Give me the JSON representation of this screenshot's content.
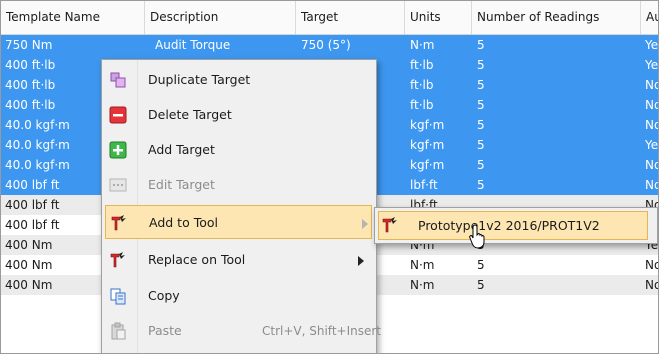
{
  "table": {
    "columns": [
      "Template Name",
      "Description",
      "Target",
      "Units",
      "Number of Readings",
      "Au"
    ],
    "rows": [
      {
        "name": "750 Nm",
        "desc": "Audit Torque",
        "target": "750 (5°)",
        "units": "N·m",
        "readings": "5",
        "au": "Ye",
        "state": "sel"
      },
      {
        "name": "400 ft·lb",
        "desc": "",
        "target": "",
        "units": "ft·lb",
        "readings": "5",
        "au": "Ye",
        "state": "sel"
      },
      {
        "name": "400 ft·lb",
        "desc": "",
        "target": "",
        "units": "ft·lb",
        "readings": "5",
        "au": "No",
        "state": "sel"
      },
      {
        "name": "400 ft·lb",
        "desc": "",
        "target": "",
        "units": "ft·lb",
        "readings": "5",
        "au": "No",
        "state": "sel"
      },
      {
        "name": "40.0 kgf·m",
        "desc": "",
        "target": "",
        "units": "kgf·m",
        "readings": "5",
        "au": "No",
        "state": "sel"
      },
      {
        "name": "40.0 kgf·m",
        "desc": "",
        "target": "",
        "units": "kgf·m",
        "readings": "5",
        "au": "Ye",
        "state": "sel"
      },
      {
        "name": "40.0 kgf·m",
        "desc": "",
        "target": "",
        "units": "kgf·m",
        "readings": "5",
        "au": "No",
        "state": "sel"
      },
      {
        "name": "400 lbf ft",
        "desc": "",
        "target": "",
        "units": "lbf·ft",
        "readings": "5",
        "au": "No",
        "state": "sel"
      },
      {
        "name": "400 lbf ft",
        "desc": "",
        "target": "",
        "units": "lbf·ft",
        "readings": "",
        "au": "No",
        "state": "alt"
      },
      {
        "name": "400 lbf ft",
        "desc": "",
        "target": "",
        "units": "lbf·ft",
        "readings": "5",
        "au": "No",
        "state": "plain"
      },
      {
        "name": "400 Nm",
        "desc": "",
        "target": "",
        "units": "N·m",
        "readings": "5",
        "au": "Ye",
        "state": "alt"
      },
      {
        "name": "400 Nm",
        "desc": "",
        "target": "",
        "units": "N·m",
        "readings": "5",
        "au": "No",
        "state": "plain"
      },
      {
        "name": "400 Nm",
        "desc": "",
        "target": "",
        "units": "N·m",
        "readings": "5",
        "au": "No",
        "state": "alt"
      }
    ]
  },
  "context_menu": {
    "items": [
      {
        "label": "Duplicate Target",
        "icon": "duplicate-icon"
      },
      {
        "label": "Delete Target",
        "icon": "delete-icon"
      },
      {
        "label": "Add Target",
        "icon": "add-icon"
      },
      {
        "label": "Edit Target",
        "icon": "edit-icon",
        "disabled": true
      },
      {
        "label": "Add to Tool",
        "icon": "tool-icon",
        "submenu": true,
        "highlighted": true
      },
      {
        "label": "Replace on Tool",
        "icon": "tool-icon",
        "submenu": true
      },
      {
        "label": "Copy",
        "icon": "copy-icon"
      },
      {
        "label": "Paste",
        "icon": "paste-icon",
        "disabled": true,
        "shortcut": "Ctrl+V, Shift+Insert"
      }
    ]
  },
  "submenu": {
    "item": "Prototype1v2 2016/PROT1V2",
    "icon": "tool-icon"
  },
  "colors": {
    "selection": "#3d97f0",
    "menu_highlight": "#fde6b2",
    "menu_highlight_border": "#e6b751",
    "alt_row": "#ebebeb"
  }
}
